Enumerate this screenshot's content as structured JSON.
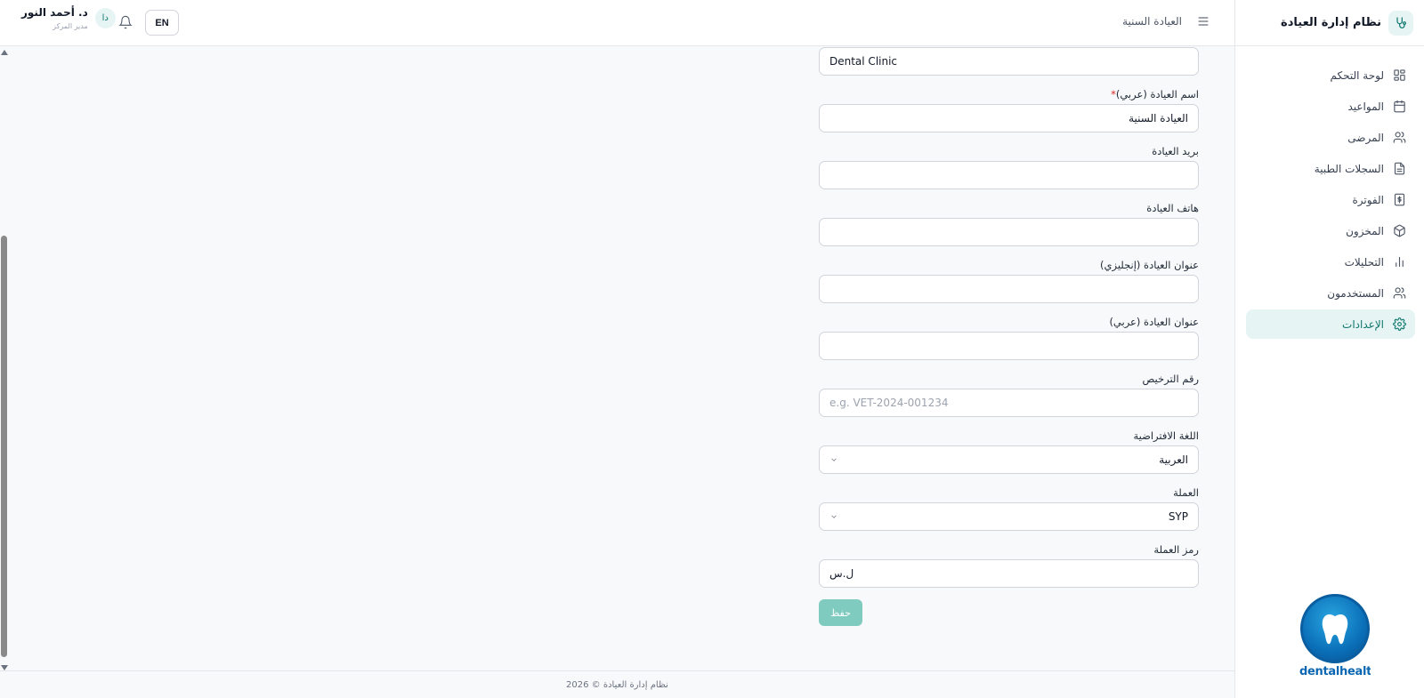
{
  "sidebar": {
    "title": "نظام إدارة العيادة",
    "items": [
      {
        "label": "لوحة التحكم",
        "icon": "dashboard-icon"
      },
      {
        "label": "المواعيد",
        "icon": "calendar-icon"
      },
      {
        "label": "المرضى",
        "icon": "users-icon"
      },
      {
        "label": "السجلات الطبية",
        "icon": "file-text-icon"
      },
      {
        "label": "الفوترة",
        "icon": "billing-icon"
      },
      {
        "label": "المخزون",
        "icon": "package-icon"
      },
      {
        "label": "التحليلات",
        "icon": "bar-chart-icon"
      },
      {
        "label": "المستخدمون",
        "icon": "user-group-icon"
      },
      {
        "label": "الإعدادات",
        "icon": "gear-icon",
        "active": true
      }
    ],
    "promo_text": "dentalhealt"
  },
  "topbar": {
    "title": "العيادة السنية",
    "language_button": "EN",
    "user": {
      "name": "د. أحمد النور",
      "role": "مدير المركز",
      "initials": "دا"
    }
  },
  "form": {
    "name_en_value": "Dental Clinic",
    "name_ar_label": "اسم العيادة (عربي)",
    "required_mark": "*",
    "name_ar_value": "العيادة السنية",
    "email_label": "بريد العيادة",
    "email_value": "",
    "phone_label": "هاتف العيادة",
    "phone_value": "",
    "address_en_label": "عنوان العيادة (إنجليزي)",
    "address_en_value": "",
    "address_ar_label": "عنوان العيادة (عربي)",
    "address_ar_value": "",
    "license_label": "رقم الترخيص",
    "license_placeholder": "e.g. VET-2024-001234",
    "language_label": "اللغة الافتراضية",
    "language_value": "العربية",
    "currency_label": "العملة",
    "currency_value": "SYP",
    "currency_symbol_label": "رمز العملة",
    "currency_symbol_value": "ل.س",
    "save_label": "حفظ"
  },
  "footer": {
    "text": "نظام إدارة العيادة © 2026"
  },
  "colors": {
    "accent": "#0f766e",
    "accent_light": "#e6f5f3",
    "save_button": "#7fcbbf",
    "required": "#dc2626"
  }
}
